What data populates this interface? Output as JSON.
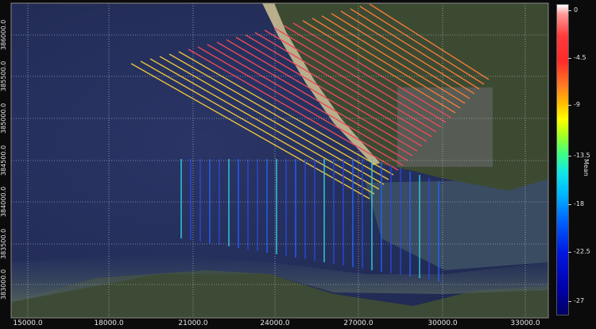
{
  "map": {
    "x_ticks": [
      "15000.0",
      "18000.0",
      "21000.0",
      "24000.0",
      "27000.0",
      "30000.0",
      "33000.0"
    ],
    "y_ticks": [
      "386000.0",
      "385500.0",
      "385000.0",
      "384500.0",
      "384000.0",
      "383500.0",
      "383000.0"
    ]
  },
  "colorbar": {
    "title": "Mean",
    "ticks": [
      "0",
      "-4.5",
      "-9",
      "-13.5",
      "-18",
      "-22.5",
      "-27"
    ],
    "range": [
      -27,
      0
    ]
  }
}
